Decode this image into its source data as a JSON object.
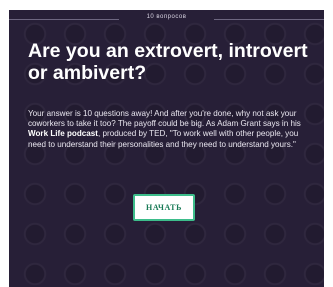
{
  "quiz": {
    "question_count": "10 вопросов",
    "title": "Are you an extrovert, introvert or ambivert?",
    "description_before": "Your answer is 10 questions away! And after you're done, why not ask your coworkers to take it too? The payoff could be big. As Adam Grant says in his ",
    "description_bold": "Work Life podcast",
    "description_after": ", produced by TED, \"To work well with other people, you need to understand their personalities and they need to understand yours.\"",
    "start_button_label": "НАЧАТЬ"
  },
  "colors": {
    "card_background": "#271f37",
    "button_border": "#3dbd8b",
    "button_text": "#177a55"
  },
  "icons": {
    "background_pattern": "emoji-face-pattern"
  }
}
